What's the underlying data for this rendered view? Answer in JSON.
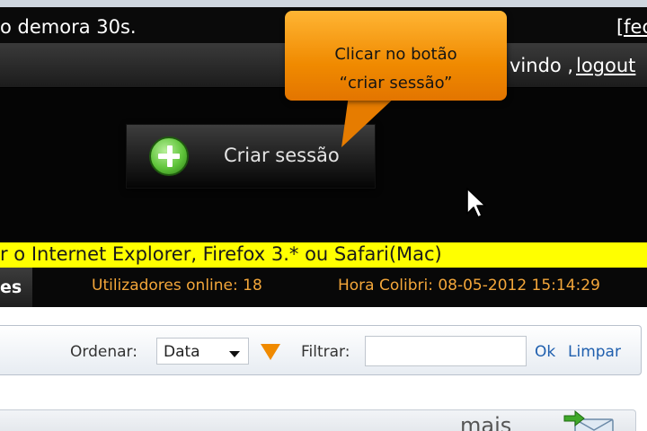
{
  "notice": {
    "text": "o demora 30s.",
    "close_label": "[fec"
  },
  "header": {
    "welcome_text": "vindo ,",
    "logout_label": "logout"
  },
  "create_session": {
    "label": "Criar sessão"
  },
  "callout": {
    "line1": "Clicar no botão",
    "line2": "“criar sessão”"
  },
  "browser_notice": {
    "text": "r o Internet Explorer, Firefox 3.* ou Safari(Mac)"
  },
  "status_bar": {
    "tab_label": "es",
    "online_users": "Utilizadores online: 18",
    "colibri_time": "Hora Colibri: 08-05-2012 15:14:29"
  },
  "filter_bar": {
    "sort_label": "Ordenar:",
    "sort_selected": "Data",
    "filter_label": "Filtrar:",
    "filter_value": "",
    "ok_label": "Ok",
    "clear_label": "Limpar"
  },
  "lower_panel": {
    "more_text": "mais"
  },
  "icons": {
    "plus": "plus-icon",
    "cursor": "mouse-cursor-icon",
    "sort_arrow": "chevron-down-icon",
    "order_toggle": "triangle-down-icon",
    "mail": "mail-forward-icon"
  },
  "colors": {
    "accent_orange": "#f08a00",
    "notice_yellow": "#ffff00",
    "status_text": "#f3a63a",
    "link_blue": "#1f5fae"
  }
}
